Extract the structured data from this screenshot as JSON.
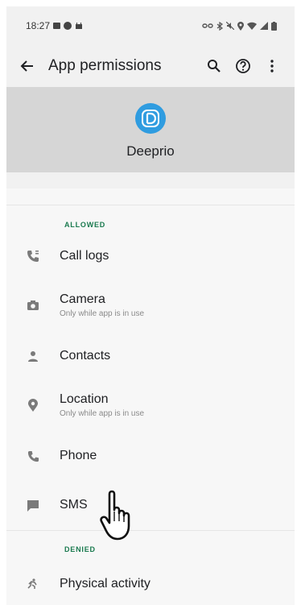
{
  "status_bar": {
    "time": "18:27"
  },
  "toolbar": {
    "title": "App permissions",
    "back_icon": "arrow-back-icon",
    "search_icon": "search-icon",
    "help_icon": "help-icon",
    "more_icon": "more-vert-icon"
  },
  "app": {
    "name": "Deeprio",
    "icon": "deeprio-logo-icon",
    "icon_color": "#2f9ce0"
  },
  "sections": {
    "allowed": {
      "label": "ALLOWED",
      "items": [
        {
          "label": "Call logs",
          "icon": "call-log-icon"
        },
        {
          "label": "Camera",
          "sub": "Only while app is in use",
          "icon": "camera-icon"
        },
        {
          "label": "Contacts",
          "icon": "person-icon"
        },
        {
          "label": "Location",
          "sub": "Only while app is in use",
          "icon": "location-pin-icon"
        },
        {
          "label": "Phone",
          "icon": "phone-icon"
        },
        {
          "label": "SMS",
          "icon": "message-icon"
        }
      ]
    },
    "denied": {
      "label": "DENIED",
      "items": [
        {
          "label": "Physical activity",
          "icon": "activity-icon"
        }
      ]
    }
  },
  "colors": {
    "section_label": "#1a7a4f",
    "header_bg": "#d6d6d6",
    "icon_gray": "#7a7a7a"
  }
}
